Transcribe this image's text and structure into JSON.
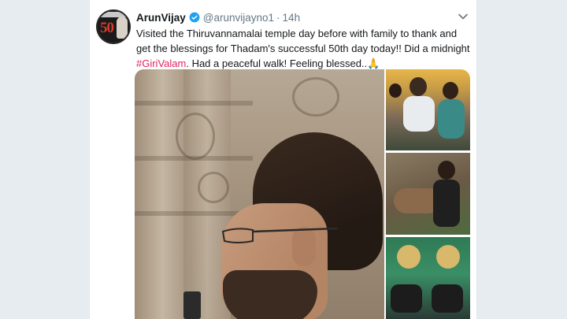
{
  "tweet": {
    "display_name": "ArunVijay",
    "handle": "@arunvijayno1",
    "separator": "·",
    "time": "14h",
    "text_before_tag": "Visited the Thiruvannamalai temple day before with family to thank and get the blessings for Thadam's successful 50th day today!! Did a midnight ",
    "hashtag": "#GiriValam",
    "text_after_tag": ". Had a peaceful walk! Feeling blessed..",
    "emoji": "🙏"
  },
  "avatar": {
    "overlay_text": "50"
  },
  "colors": {
    "verified_blue": "#1da1f2",
    "hashtag_pink": "#e0245e",
    "muted_gray": "#657786",
    "background": "#e6ecf0"
  },
  "icons": {
    "verified": "verified-badge-icon",
    "menu": "chevron-down-icon"
  }
}
